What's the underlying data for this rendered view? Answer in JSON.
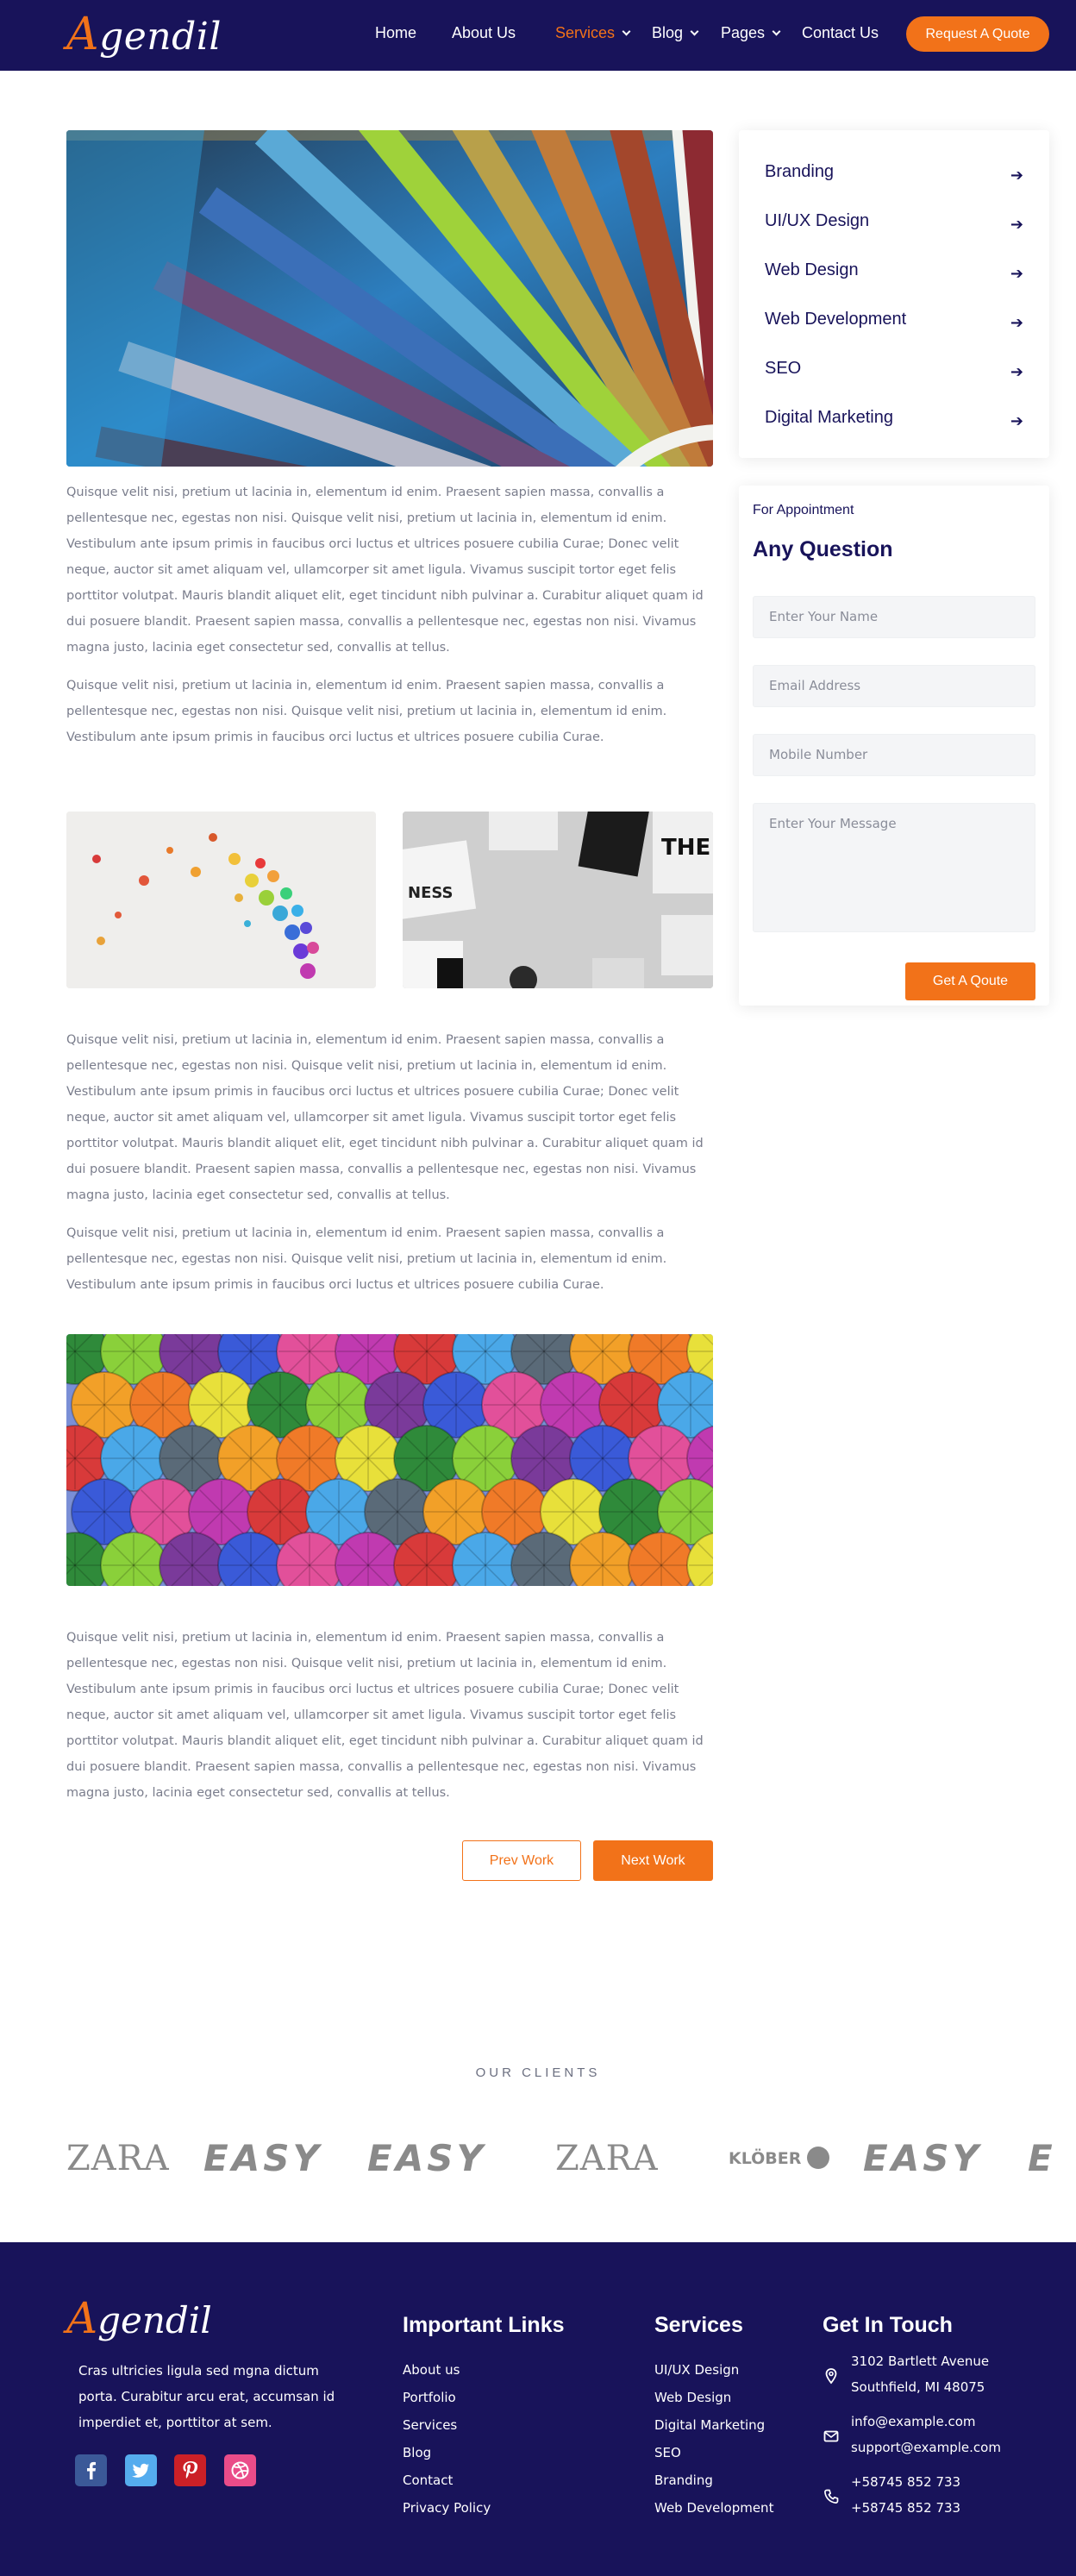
{
  "header": {
    "logo_first": "A",
    "logo_rest": "gendil",
    "nav": [
      {
        "label": "Home"
      },
      {
        "label": "About Us"
      },
      {
        "label": "Services"
      },
      {
        "label": "Blog"
      },
      {
        "label": "Pages"
      },
      {
        "label": "Contact Us"
      }
    ],
    "quote_button": "Request A Quote"
  },
  "content": {
    "para_long": "Quisque velit nisi, pretium ut lacinia in, elementum id enim. Praesent sapien massa, convallis a pellentesque nec, egestas non nisi. Quisque velit nisi, pretium ut lacinia in, elementum id enim. Vestibulum ante ipsum primis in faucibus orci luctus et ultrices posuere cubilia Curae; Donec velit neque, auctor sit amet aliquam vel, ullamcorper sit amet ligula. Vivamus suscipit tortor eget felis porttitor volutpat. Mauris blandit aliquet elit, eget tincidunt nibh pulvinar a. Curabitur aliquet quam id dui posuere blandit. Praesent sapien massa, convallis a pellentesque nec, egestas non nisi. Vivamus magna justo, lacinia eget consectetur sed, convallis at tellus.",
    "para_short": "Quisque velit nisi, pretium ut lacinia in, elementum id enim. Praesent sapien massa, convallis a pellentesque nec, egestas non nisi. Quisque velit nisi, pretium ut lacinia in, elementum id enim. Vestibulum ante ipsum primis in faucibus orci luctus et ultrices posuere cubilia Curae.",
    "prev_button": "Prev Work",
    "next_button": "Next Work"
  },
  "sidebar": {
    "services": [
      {
        "label": "Branding"
      },
      {
        "label": "UI/UX Design"
      },
      {
        "label": "Web Design"
      },
      {
        "label": "Web Development"
      },
      {
        "label": "SEO"
      },
      {
        "label": "Digital Marketing"
      }
    ],
    "appointment_label": "For Appointment",
    "appointment_title": "Any Question",
    "name_placeholder": "Enter Your Name",
    "email_placeholder": "Email Address",
    "mobile_placeholder": "Mobile Number",
    "message_placeholder": "Enter Your Message",
    "submit_label": "Get A Qoute"
  },
  "clients": {
    "title": "OUR CLIENTS",
    "logos": [
      "ZARA",
      "EASY",
      "EASY",
      "ZARA",
      "KLÖBER",
      "EASY",
      "E"
    ]
  },
  "footer": {
    "logo_first": "A",
    "logo_rest": "gendil",
    "description": "Cras ultricies ligula sed mgna dictum porta. Curabitur arcu erat, accumsan id imperdiet et, porttitor at sem.",
    "important_links_title": "Important Links",
    "important_links": [
      "About us",
      "Portfolio",
      "Services",
      "Blog",
      "Contact",
      "Privacy Policy"
    ],
    "services_title": "Services",
    "services": [
      "UI/UX Design",
      "Web Design",
      "Digital Marketing",
      "SEO",
      "Branding",
      "Web Development"
    ],
    "contact_title": "Get In Touch",
    "address_line1": "3102 Bartlett Avenue",
    "address_line2": "Southfield, MI 48075",
    "email1": "info@example.com",
    "email2": "support@example.com",
    "phone1": "+58745 852 733",
    "phone2": "+58745 852 733"
  },
  "colors": {
    "navy": "#18135a",
    "accent": "#f27219",
    "text": "#7a7d8c",
    "facebook": "#3b5998",
    "twitter": "#55acee",
    "pinterest": "#cb2027",
    "dribbble": "#ea4c89"
  },
  "icons": {
    "arrow": "arrow-right-icon",
    "location": "location-pin-icon",
    "email": "envelope-icon",
    "phone": "phone-icon"
  }
}
